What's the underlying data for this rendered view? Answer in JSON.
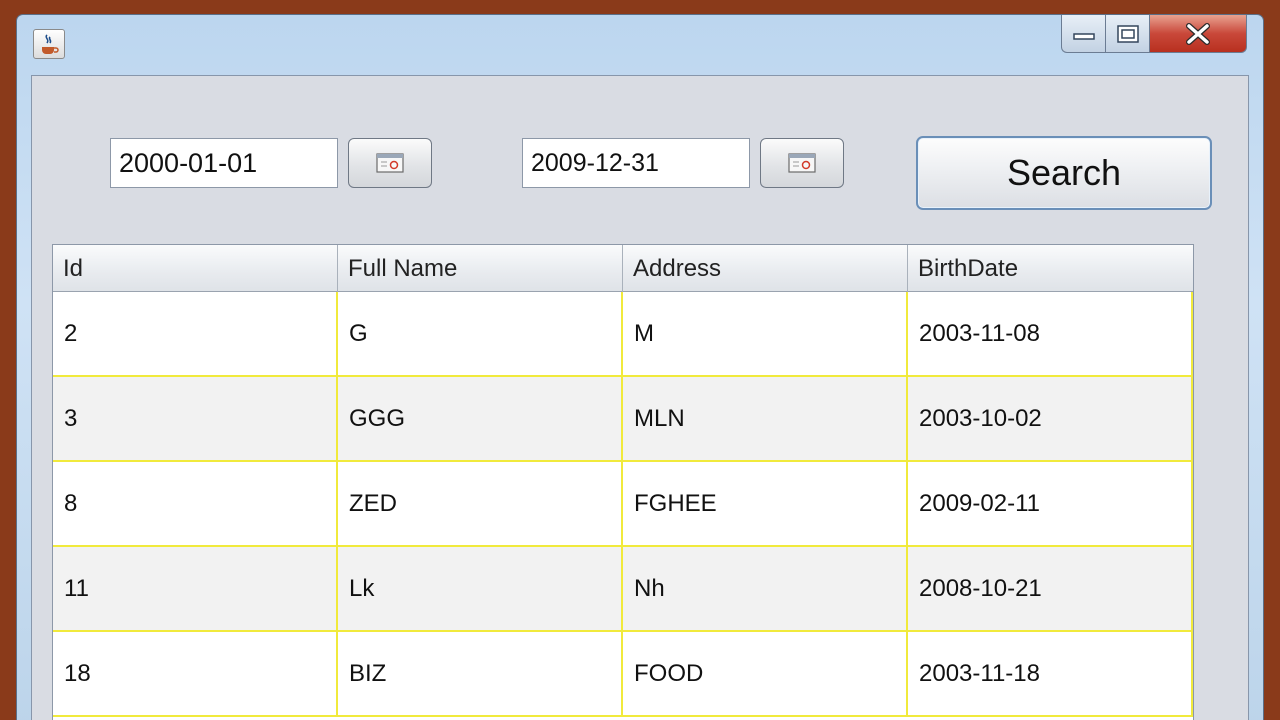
{
  "window": {
    "title": "",
    "icons": {
      "app": "java-coffee-icon",
      "minimize": "minimize-icon",
      "maximize": "maximize-icon",
      "close": "close-icon"
    }
  },
  "filters": {
    "from_date": "2000-01-01",
    "to_date": "2009-12-31",
    "calendar_icon": "calendar-icon",
    "search_label": "Search"
  },
  "table": {
    "columns": [
      "Id",
      "Full Name",
      "Address",
      "BirthDate"
    ],
    "rows": [
      [
        "2",
        "G",
        "M",
        "2003-11-08"
      ],
      [
        "3",
        "GGG",
        "MLN",
        "2003-10-02"
      ],
      [
        "8",
        "ZED",
        "FGHEE",
        "2009-02-11"
      ],
      [
        "11",
        "Lk",
        "Nh",
        "2008-10-21"
      ],
      [
        "18",
        "BIZ",
        "FOOD",
        "2003-11-18"
      ]
    ]
  },
  "colors": {
    "desktop": "#8a3a1a",
    "grid_lines": "#f1ea3c",
    "client_bg": "#d9dce3",
    "close_button": "#c9483a"
  }
}
